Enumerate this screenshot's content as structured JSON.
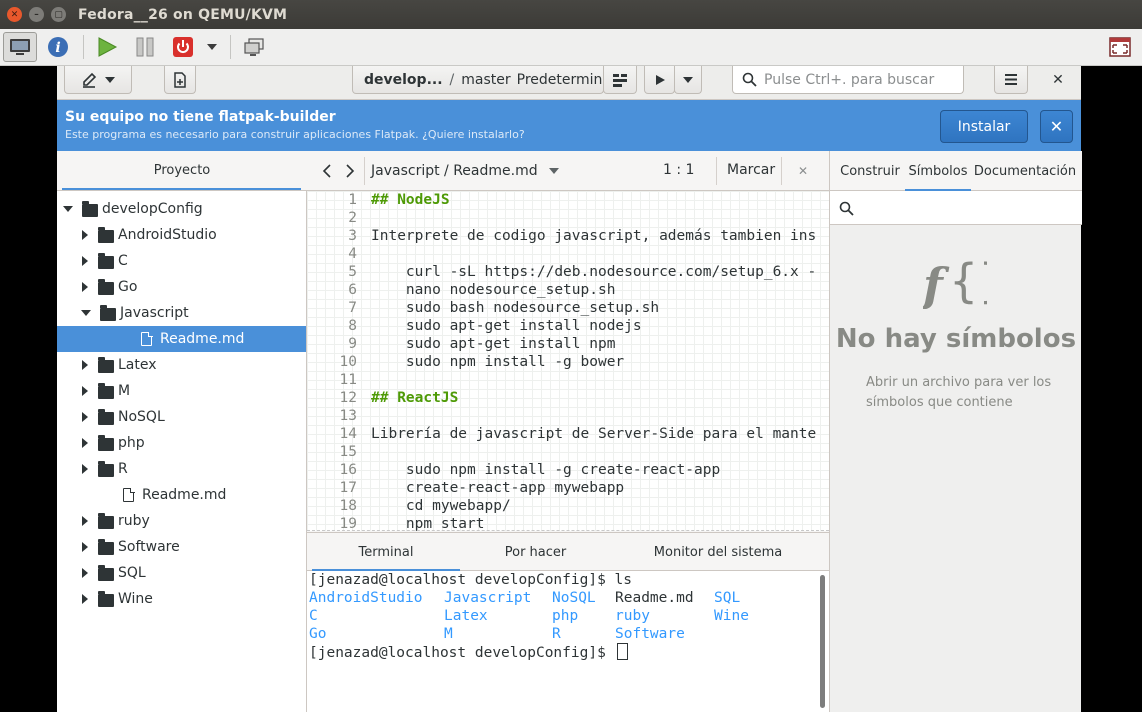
{
  "window": {
    "title": "Fedora__26 on QEMU/KVM"
  },
  "host_toolbar": {
    "buttons": [
      "console-view",
      "info",
      "run",
      "pause",
      "power",
      "power-menu",
      "screenshots",
      "fullscreen"
    ]
  },
  "header": {
    "branch_project": "develop...",
    "branch_separator": "/",
    "branch_name": "master",
    "config": "Predetermina...",
    "search_placeholder": "Pulse Ctrl+. para buscar"
  },
  "infobar": {
    "title": "Su equipo no tiene flatpak-builder",
    "subtitle": "Este programa es necesario para construir aplicaciones Flatpak. ¿Quiere instalarlo?",
    "install_label": "Instalar",
    "close_label": "✕"
  },
  "left_panel": {
    "tab": "Proyecto",
    "tree": [
      {
        "label": "developConfig",
        "type": "folder",
        "expanded": true,
        "depth": 0
      },
      {
        "label": "AndroidStudio",
        "type": "folder",
        "expanded": false,
        "depth": 1
      },
      {
        "label": "C",
        "type": "folder",
        "expanded": false,
        "depth": 1
      },
      {
        "label": "Go",
        "type": "folder",
        "expanded": false,
        "depth": 1
      },
      {
        "label": "Javascript",
        "type": "folder",
        "expanded": true,
        "depth": 1
      },
      {
        "label": "Readme.md",
        "type": "file",
        "selected": true,
        "depth": 2
      },
      {
        "label": "Latex",
        "type": "folder",
        "expanded": false,
        "depth": 1
      },
      {
        "label": "M",
        "type": "folder",
        "expanded": false,
        "depth": 1
      },
      {
        "label": "NoSQL",
        "type": "folder",
        "expanded": false,
        "depth": 1
      },
      {
        "label": "php",
        "type": "folder",
        "expanded": false,
        "depth": 1
      },
      {
        "label": "R",
        "type": "folder",
        "expanded": false,
        "depth": 1
      },
      {
        "label": "Readme.md",
        "type": "file",
        "selected": false,
        "depth": 1
      },
      {
        "label": "ruby",
        "type": "folder",
        "expanded": false,
        "depth": 1
      },
      {
        "label": "Software",
        "type": "folder",
        "expanded": false,
        "depth": 1
      },
      {
        "label": "SQL",
        "type": "folder",
        "expanded": false,
        "depth": 1
      },
      {
        "label": "Wine",
        "type": "folder",
        "expanded": false,
        "depth": 1
      }
    ]
  },
  "editor": {
    "path": "Javascript / Readme.md",
    "position": "1 : 1",
    "mark_label": "Marcar",
    "lines": [
      {
        "n": "1",
        "text": "## NodeJS",
        "heading": true
      },
      {
        "n": "2",
        "text": ""
      },
      {
        "n": "3",
        "text": "Interprete de codigo javascript, además tambien ins"
      },
      {
        "n": "4",
        "text": ""
      },
      {
        "n": "5",
        "text": "    curl -sL https://deb.nodesource.com/setup_6.x -"
      },
      {
        "n": "6",
        "text": "    nano nodesource_setup.sh"
      },
      {
        "n": "7",
        "text": "    sudo bash nodesource_setup.sh"
      },
      {
        "n": "8",
        "text": "    sudo apt-get install nodejs"
      },
      {
        "n": "9",
        "text": "    sudo apt-get install npm"
      },
      {
        "n": "10",
        "text": "    sudo npm install -g bower"
      },
      {
        "n": "11",
        "text": ""
      },
      {
        "n": "12",
        "text": "## ReactJS",
        "heading": true
      },
      {
        "n": "13",
        "text": ""
      },
      {
        "n": "14",
        "text": "Librería de javascript de Server-Side para el mante"
      },
      {
        "n": "15",
        "text": ""
      },
      {
        "n": "16",
        "text": "    sudo npm install -g create-react-app"
      },
      {
        "n": "17",
        "text": "    create-react-app mywebapp"
      },
      {
        "n": "18",
        "text": "    cd mywebapp/"
      },
      {
        "n": "19",
        "text": "    npm start"
      }
    ]
  },
  "bottom_panel": {
    "tabs": [
      "Terminal",
      "Por hacer",
      "Monitor del sistema"
    ],
    "terminal": {
      "prompt1": "[jenazad@localhost developConfig]$ ls",
      "ls_rows": [
        [
          "AndroidStudio",
          "Javascript",
          "NoSQL",
          "Readme.md",
          "SQL"
        ],
        [
          "C",
          "Latex",
          "php",
          "ruby",
          "Wine"
        ],
        [
          "Go",
          "M",
          "R",
          "Software",
          ""
        ]
      ],
      "prompt2": "[jenazad@localhost developConfig]$ "
    }
  },
  "right_panel": {
    "tabs": [
      "Construir",
      "Símbolos",
      "Documentación"
    ],
    "empty_icon": "ƒ{}",
    "empty_title": "No hay símbolos",
    "empty_subtitle": "Abrir un archivo para ver los símbolos que contiene"
  },
  "colors": {
    "accent": "#4a90d9",
    "heading": "#4e9a06",
    "terminal_dir": "#3399ff"
  }
}
